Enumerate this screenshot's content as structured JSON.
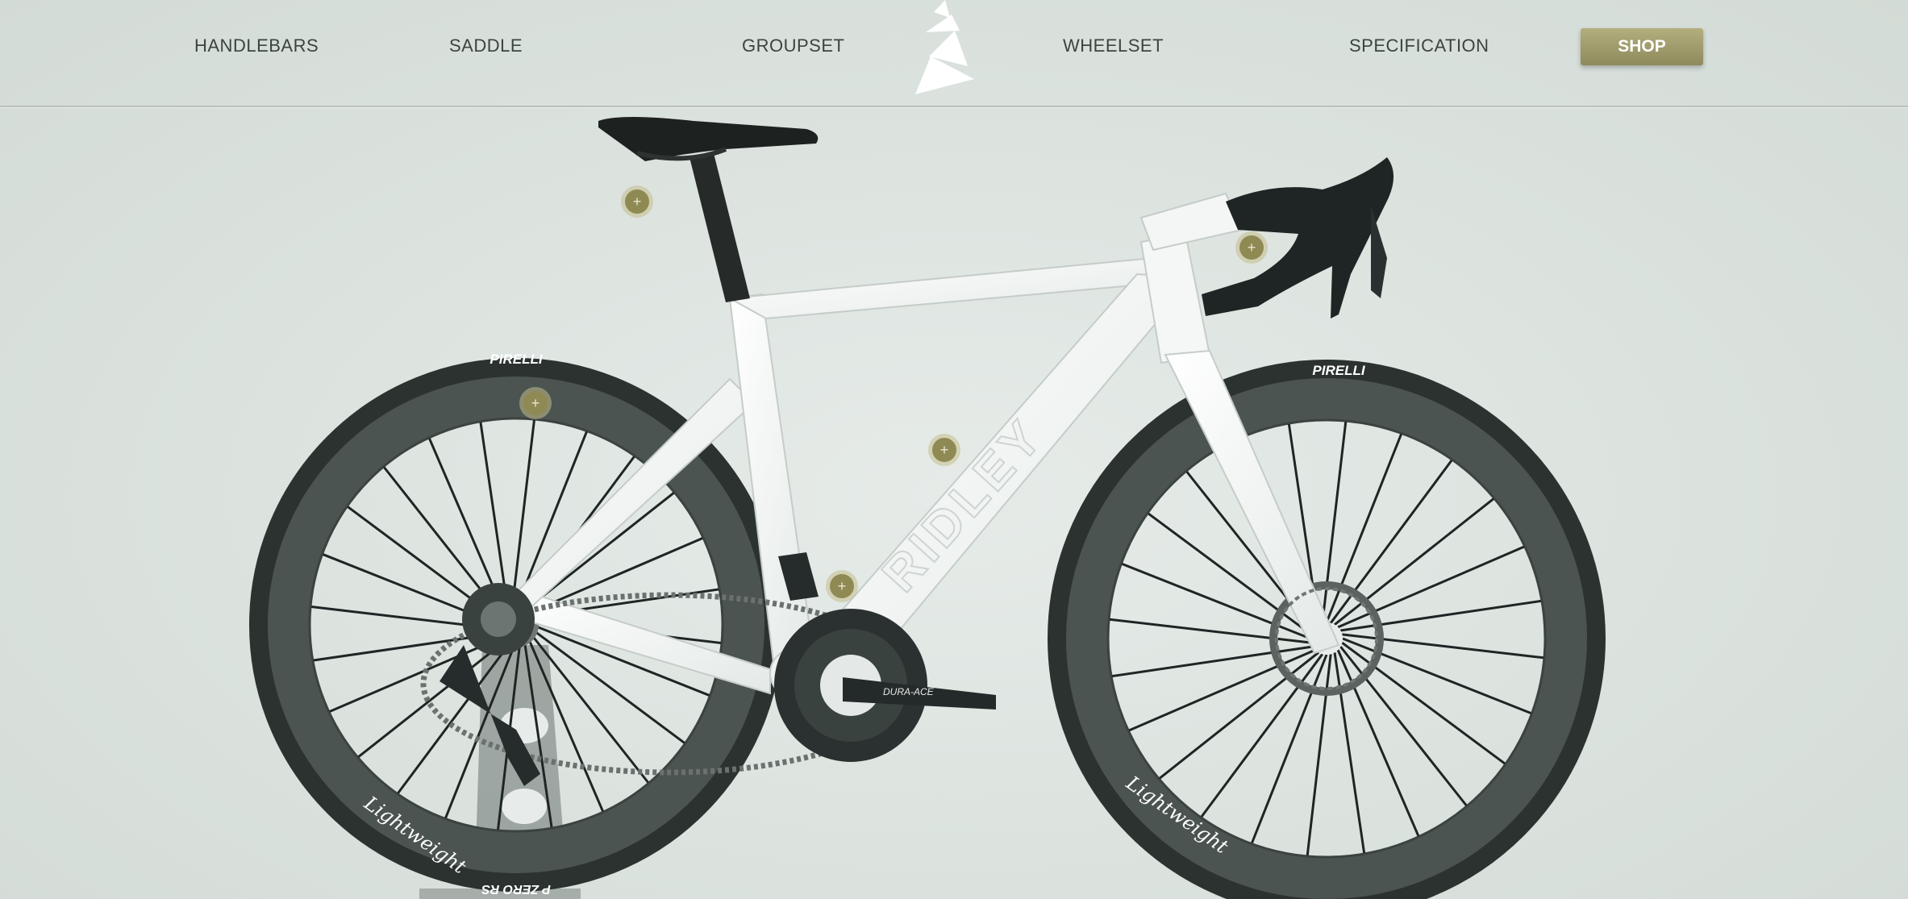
{
  "nav": {
    "links": [
      "HANDLEBARS",
      "SADDLE",
      "GROUPSET",
      "WHEELSET",
      "SPECIFICATION"
    ],
    "shop_label": "SHOP"
  },
  "logo": {
    "icon": "brand-logo-icon"
  },
  "bike": {
    "brand": "RIDLEY",
    "tyre_brand": "PIRELLI",
    "tyre_model": "P ZERO RS",
    "wheel_brand": "Lightweight",
    "groupset": "DURA-ACE"
  },
  "hotspots": {
    "symbol": "+",
    "items": [
      "saddle",
      "handlebars",
      "rear-wheel",
      "frame",
      "groupset"
    ]
  },
  "colors": {
    "accent": "#9a955f",
    "background": "#dde4e0",
    "nav_text": "#3c4440"
  }
}
